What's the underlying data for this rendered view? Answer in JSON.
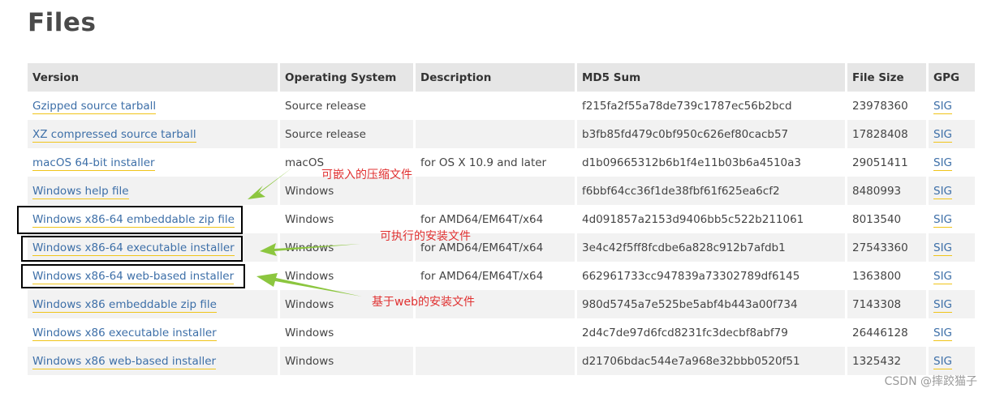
{
  "page": {
    "title": "Files"
  },
  "table": {
    "headers": [
      "Version",
      "Operating System",
      "Description",
      "MD5 Sum",
      "File Size",
      "GPG"
    ],
    "rows": [
      {
        "version": "Gzipped source tarball",
        "os": "Source release",
        "description": "",
        "md5": "f215fa2f55a78de739c1787ec56b2bcd",
        "size": "23978360",
        "gpg": "SIG"
      },
      {
        "version": "XZ compressed source tarball",
        "os": "Source release",
        "description": "",
        "md5": "b3fb85fd479c0bf950c626ef80cacb57",
        "size": "17828408",
        "gpg": "SIG"
      },
      {
        "version": "macOS 64-bit installer",
        "os": "macOS",
        "description": "for OS X 10.9 and later",
        "md5": "d1b09665312b6b1f4e11b03b6a4510a3",
        "size": "29051411",
        "gpg": "SIG"
      },
      {
        "version": "Windows help file",
        "os": "Windows",
        "description": "",
        "md5": "f6bbf64cc36f1de38fbf61f625ea6cf2",
        "size": "8480993",
        "gpg": "SIG"
      },
      {
        "version": "Windows x86-64 embeddable zip file",
        "os": "Windows",
        "description": "for AMD64/EM64T/x64",
        "md5": "4d091857a2153d9406bb5c522b211061",
        "size": "8013540",
        "gpg": "SIG"
      },
      {
        "version": "Windows x86-64 executable installer",
        "os": "Windows",
        "description": "for AMD64/EM64T/x64",
        "md5": "3e4c42f5ff8fcdbe6a828c912b7afdb1",
        "size": "27543360",
        "gpg": "SIG"
      },
      {
        "version": "Windows x86-64 web-based installer",
        "os": "Windows",
        "description": "for AMD64/EM64T/x64",
        "md5": "662961733cc947839a73302789df6145",
        "size": "1363800",
        "gpg": "SIG"
      },
      {
        "version": "Windows x86 embeddable zip file",
        "os": "Windows",
        "description": "",
        "md5": "980d5745a7e525be5abf4b443a00f734",
        "size": "7143308",
        "gpg": "SIG"
      },
      {
        "version": "Windows x86 executable installer",
        "os": "Windows",
        "description": "",
        "md5": "2d4c7de97d6fcd8231fc3decbf8abf79",
        "size": "26446128",
        "gpg": "SIG"
      },
      {
        "version": "Windows x86 web-based installer",
        "os": "Windows",
        "description": "",
        "md5": "d21706bdac544e7a968e32bbb0520f51",
        "size": "1325432",
        "gpg": "SIG"
      }
    ]
  },
  "annotations": {
    "embeddable": "可嵌入的压缩文件",
    "executable": "可执行的安装文件",
    "web_based": "基于web的安装文件",
    "arrow_color": "#8cc63f",
    "box_color": "#000000",
    "text_color": "#e03030"
  },
  "watermark": "CSDN @摔跤猫子"
}
